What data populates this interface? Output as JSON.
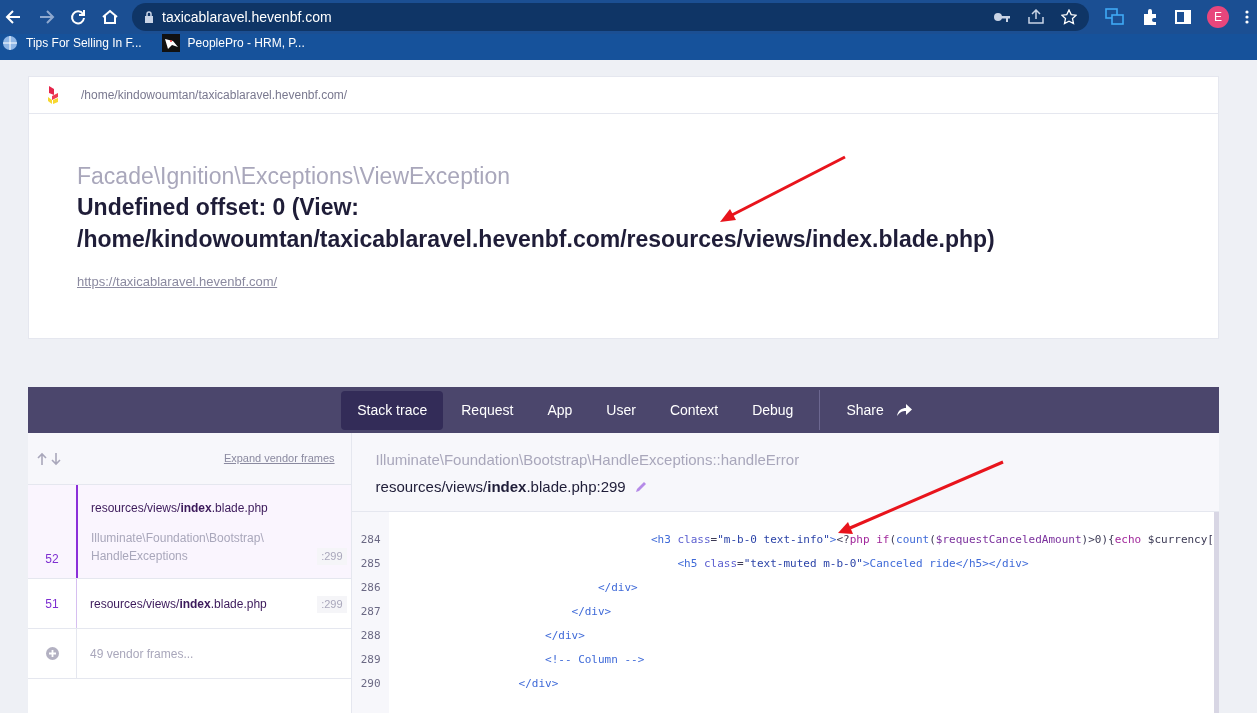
{
  "browser": {
    "url": "taxicablaravel.hevenbf.com",
    "profile_initial": "E",
    "bookmarks": [
      {
        "label": "Tips For Selling In F..."
      },
      {
        "label": "PeoplePro - HRM, P..."
      }
    ]
  },
  "header": {
    "path": "/home/kindowoumtan/taxicablaravel.hevenbf.com/"
  },
  "exception": {
    "class": "Facade\\Ignition\\Exceptions\\ViewException",
    "message": "Undefined offset: 0 (View: /home/kindowoumtan/taxicablaravel.hevenbf.com/resources/views/index.blade.php)",
    "url": "https://taxicablaravel.hevenbf.com/"
  },
  "tabs": [
    {
      "label": "Stack trace",
      "selected": true
    },
    {
      "label": "Request",
      "selected": false
    },
    {
      "label": "App",
      "selected": false
    },
    {
      "label": "User",
      "selected": false
    },
    {
      "label": "Context",
      "selected": false
    },
    {
      "label": "Debug",
      "selected": false
    }
  ],
  "share": {
    "label": "Share"
  },
  "frames_toolbar": {
    "expand_link": "Expand vendor frames"
  },
  "frames": [
    {
      "kind": "frame",
      "number": "52",
      "file": "resources/views/**index**.blade.php",
      "class": "Illuminate\\Foundation\\Bootstrap\\HandleExceptions",
      "line": ":299",
      "selected": true
    },
    {
      "kind": "frame",
      "number": "51",
      "file": "resources/views/**index**.blade.php",
      "line": ":299",
      "selected": false
    },
    {
      "kind": "vendor_group",
      "label": "49 vendor frames..."
    }
  ],
  "frame_detail": {
    "class": "Illuminate\\Foundation\\Bootstrap\\HandleExceptions::handleError",
    "file": "resources/views/**index**.blade.php:299"
  },
  "code": [
    {
      "number": "284",
      "segments": [
        {
          "kind": "tag",
          "text": "                                    <h3"
        },
        {
          "kind": "attr",
          "text": " class"
        },
        {
          "kind": "plain",
          "text": "="
        },
        {
          "kind": "string",
          "text": "\"m-b-0 text-info\""
        },
        {
          "kind": "tag",
          "text": ">"
        },
        {
          "kind": "plain",
          "text": "<?"
        },
        {
          "kind": "keyword",
          "text": "php"
        },
        {
          "kind": "keyword",
          "text": " if"
        },
        {
          "kind": "plain",
          "text": "("
        },
        {
          "kind": "func",
          "text": "count"
        },
        {
          "kind": "plain",
          "text": "("
        },
        {
          "kind": "var",
          "text": "$requestCanceledAmount"
        },
        {
          "kind": "plain",
          "text": ")>0){"
        },
        {
          "kind": "keyword",
          "text": "echo"
        },
        {
          "kind": "plain",
          "text": " $currency["
        }
      ]
    },
    {
      "number": "285",
      "segments": [
        {
          "kind": "tag",
          "text": "                                        <h5"
        },
        {
          "kind": "attr",
          "text": " class"
        },
        {
          "kind": "plain",
          "text": "="
        },
        {
          "kind": "string",
          "text": "\"text-muted m-b-0\""
        },
        {
          "kind": "tag",
          "text": ">Canceled ride</h5></div>"
        }
      ]
    },
    {
      "number": "286",
      "segments": [
        {
          "kind": "tag",
          "text": "                            </div>"
        }
      ]
    },
    {
      "number": "287",
      "segments": [
        {
          "kind": "tag",
          "text": "                        </div>"
        }
      ]
    },
    {
      "number": "288",
      "segments": [
        {
          "kind": "tag",
          "text": "                    </div>"
        }
      ]
    },
    {
      "number": "289",
      "segments": [
        {
          "kind": "tag",
          "text": "                    <!-- Column -->"
        }
      ]
    },
    {
      "number": "290",
      "segments": [
        {
          "kind": "tag",
          "text": "                </div>"
        }
      ]
    }
  ]
}
